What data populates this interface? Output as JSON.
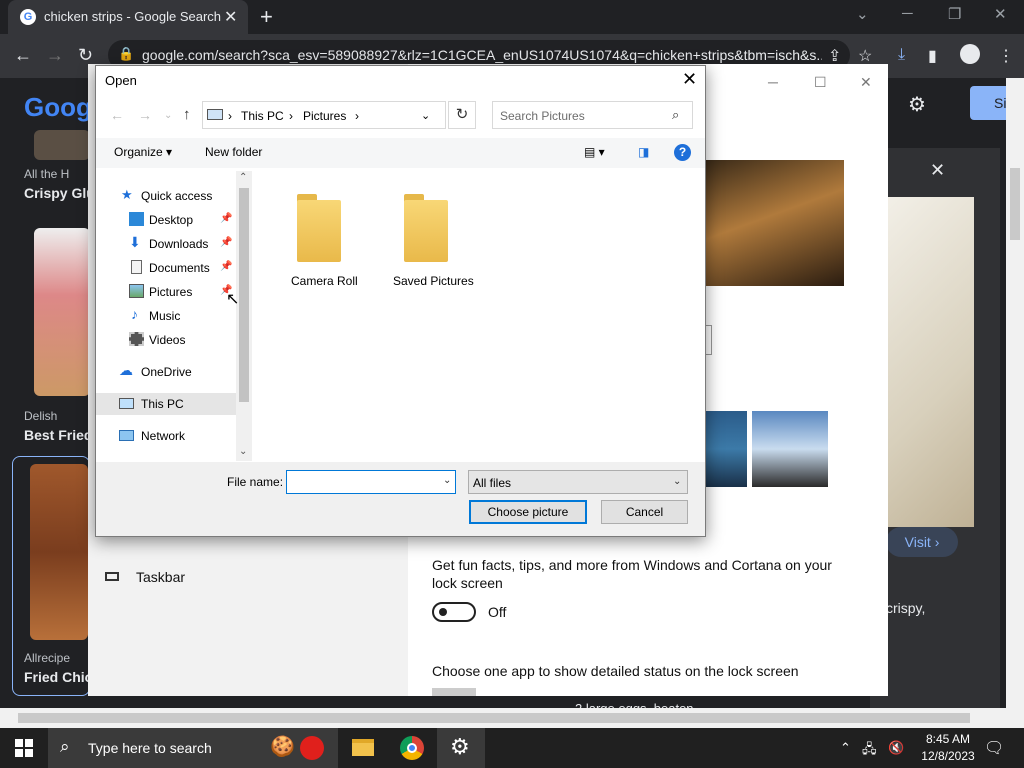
{
  "browser": {
    "tab_title": "chicken strips - Google Search",
    "new_tab": "+",
    "url": "google.com/search?sca_esv=589088927&rlz=1C1GCEA_enUS1074US1074&q=chicken+strips&tbm=isch&s..."
  },
  "page": {
    "logo": "Goog",
    "results": [
      {
        "source": "All the H",
        "title": "Crispy Glu"
      },
      {
        "source": "Delish",
        "title": "Best Fried"
      },
      {
        "source": "Allrecipe",
        "title": "Fried Chic"
      }
    ],
    "viewer": {
      "visit_label": "Visit ›",
      "desc": "crispy,",
      "ingredient": "2 large eggs, beaten"
    }
  },
  "settings": {
    "fun_facts": "Get fun facts, tips, and more from Windows and Cortana on your lock screen",
    "toggle_state": "Off",
    "choose_app": "Choose one app to show detailed status on the lock screen",
    "taskbar": "Taskbar"
  },
  "dialog": {
    "title": "Open",
    "breadcrumb": [
      "This PC",
      "Pictures"
    ],
    "search_placeholder": "Search Pictures",
    "organize": "Organize ▾",
    "new_folder": "New folder",
    "nav": {
      "quick_access": "Quick access",
      "items": [
        "Desktop",
        "Downloads",
        "Documents",
        "Pictures",
        "Music",
        "Videos"
      ],
      "onedrive": "OneDrive",
      "this_pc": "This PC",
      "network": "Network"
    },
    "folders": [
      "Camera Roll",
      "Saved Pictures"
    ],
    "file_name_label": "File name:",
    "file_name_value": "",
    "filter": "All files",
    "choose_button": "Choose picture",
    "cancel_button": "Cancel"
  },
  "taskbar": {
    "search_placeholder": "Type here to search",
    "time": "8:45 AM",
    "date": "12/8/2023"
  }
}
